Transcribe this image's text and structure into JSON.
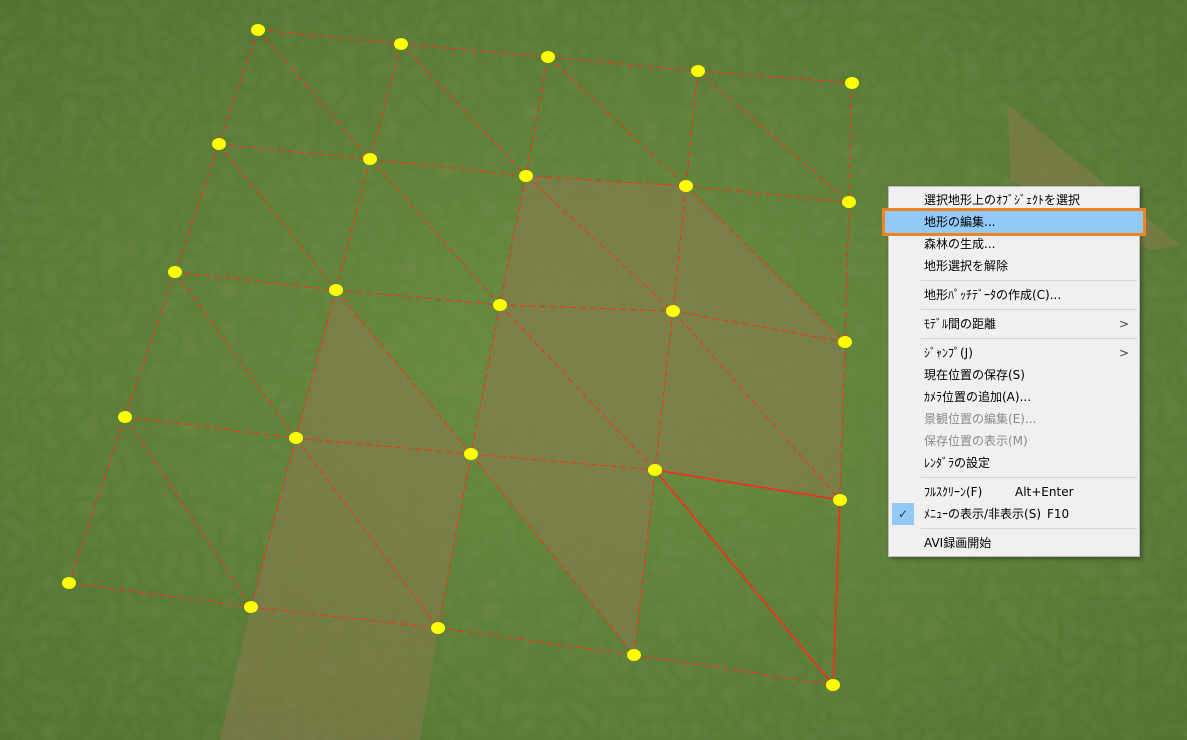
{
  "context_menu": {
    "items": [
      {
        "label": "選択地形上のｵﾌﾞｼﾞｪｸﾄを選択"
      },
      {
        "label": "地形の編集..."
      },
      {
        "label": "森林の生成..."
      },
      {
        "label": "地形選択を解除"
      },
      {
        "label": "地形ﾊﾟｯﾁﾃﾞｰﾀの作成(C)..."
      },
      {
        "label": "ﾓﾃﾞﾙ間の距離"
      },
      {
        "label": "ｼﾞｬﾝﾌﾟ(J)"
      },
      {
        "label": "現在位置の保存(S)"
      },
      {
        "label": "ｶﾒﾗ位置の追加(A)..."
      },
      {
        "label": "景観位置の編集(E)..."
      },
      {
        "label": "保存位置の表示(M)"
      },
      {
        "label": "ﾚﾝﾀﾞﾗの設定"
      },
      {
        "label": "ﾌﾙｽｸﾘｰﾝ(F)",
        "shortcut": "Alt+Enter"
      },
      {
        "label": "ﾒﾆｭｰの表示/非表示(S)",
        "shortcut": "F10",
        "checked": true
      },
      {
        "label": "AVI録画開始"
      }
    ],
    "submenu_arrow": ">",
    "check_mark": "✓",
    "highlight_color": "#91c9f7",
    "focus_outline_color": "#f58220"
  },
  "colors": {
    "grass": "#5d7f36",
    "vertex": "#ffff00",
    "edge": "#ff2a1a"
  }
}
